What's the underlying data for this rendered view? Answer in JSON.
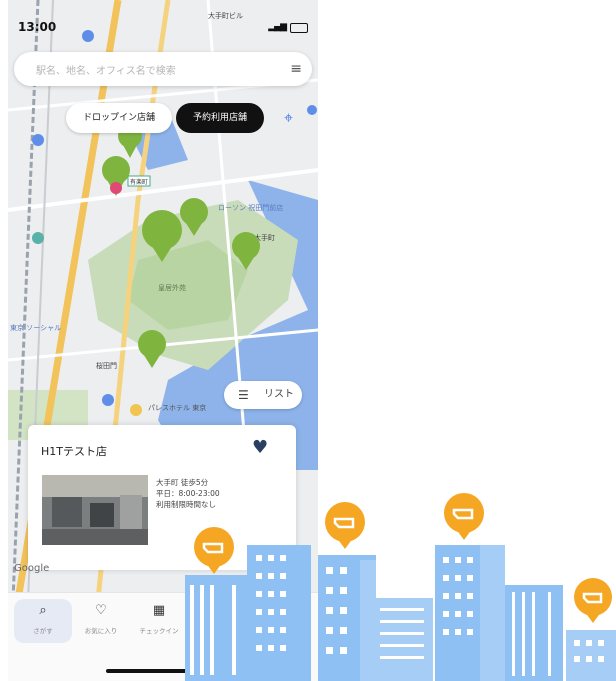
{
  "status_bar": {
    "time": "13:00"
  },
  "search": {
    "placeholder": "駅名、地名、オフィス名で検索",
    "filter_icon": "filter-lines-icon"
  },
  "chips": {
    "dropin": "ドロップイン店舗",
    "reserve": "予約利用店舗"
  },
  "map": {
    "labels": {
      "lawson": "ローソン 祝田門前店",
      "palace": "皇居外苑",
      "station_label": "大手町",
      "tower": "大手町ビル",
      "bottom_poi": "パレスホテル 東京",
      "left_area": "東京 ソーシャル",
      "station_box": "有楽町",
      "sakuradamon": "桜田門"
    },
    "pin_color": "#7fb53f"
  },
  "list_button": {
    "label": "リスト"
  },
  "card": {
    "name": "H1Tテスト店",
    "info_lines": [
      "大手町 徒歩5分",
      "平日：8:00-23:00",
      "利用制限時間なし"
    ],
    "favorite_color": "#2a3f61"
  },
  "google_logo": "Google",
  "tabs": [
    {
      "label": "さがす",
      "icon": "search-icon"
    },
    {
      "label": "お気に入り",
      "icon": "heart-outline-icon"
    },
    {
      "label": "チェックイン",
      "icon": "qr-code-icon"
    }
  ],
  "illustration": {
    "building_color": "#8ec0f3",
    "sign_color": "#f5a623"
  }
}
